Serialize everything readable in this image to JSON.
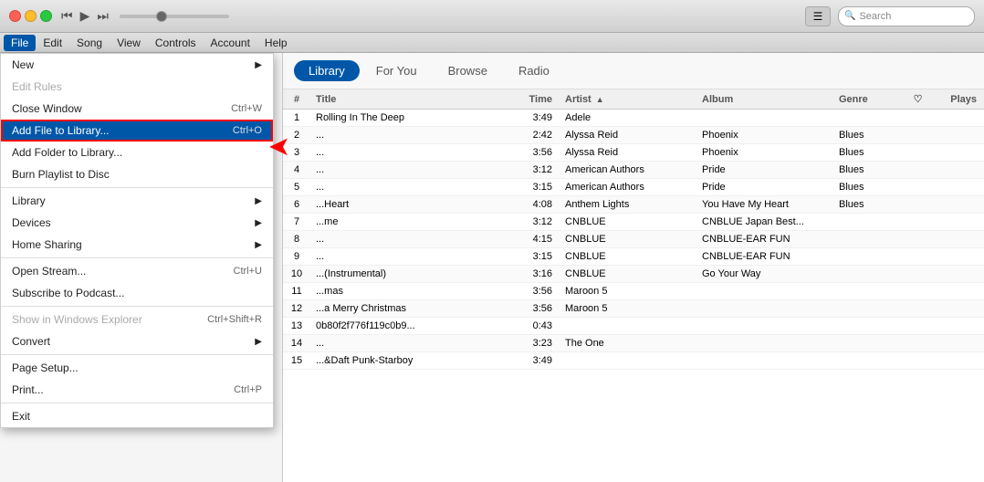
{
  "titleBar": {
    "searchPlaceholder": "Search",
    "appleIcon": "",
    "listViewIcon": "☰"
  },
  "menuBar": {
    "items": [
      "File",
      "Edit",
      "Song",
      "View",
      "Controls",
      "Account",
      "Help"
    ]
  },
  "fileMenu": {
    "items": [
      {
        "label": "New",
        "shortcut": "",
        "arrow": "▶",
        "disabled": false
      },
      {
        "label": "Edit Rules",
        "shortcut": "",
        "arrow": "",
        "disabled": true
      },
      {
        "label": "Close Window",
        "shortcut": "Ctrl+W",
        "arrow": "",
        "disabled": false
      },
      {
        "label": "Add File to Library...",
        "shortcut": "Ctrl+O",
        "arrow": "",
        "disabled": false,
        "highlighted": true
      },
      {
        "label": "Add Folder to Library...",
        "shortcut": "",
        "arrow": "",
        "disabled": false
      },
      {
        "label": "Burn Playlist to Disc",
        "shortcut": "",
        "arrow": "",
        "disabled": false
      },
      {
        "separator": true
      },
      {
        "label": "Library",
        "shortcut": "",
        "arrow": "▶",
        "disabled": false
      },
      {
        "label": "Devices",
        "shortcut": "",
        "arrow": "▶",
        "disabled": false
      },
      {
        "label": "Home Sharing",
        "shortcut": "",
        "arrow": "▶",
        "disabled": false
      },
      {
        "separator": true
      },
      {
        "label": "Open Stream...",
        "shortcut": "Ctrl+U",
        "arrow": "",
        "disabled": false
      },
      {
        "label": "Subscribe to Podcast...",
        "shortcut": "",
        "arrow": "",
        "disabled": false
      },
      {
        "separator": true
      },
      {
        "label": "Show in Windows Explorer",
        "shortcut": "Ctrl+Shift+R",
        "arrow": "",
        "disabled": true
      },
      {
        "label": "Convert",
        "shortcut": "",
        "arrow": "▶",
        "disabled": false
      },
      {
        "separator": true
      },
      {
        "label": "Page Setup...",
        "shortcut": "",
        "arrow": "",
        "disabled": false
      },
      {
        "label": "Print...",
        "shortcut": "Ctrl+P",
        "arrow": "",
        "disabled": false
      },
      {
        "separator": true
      },
      {
        "label": "Exit",
        "shortcut": "",
        "arrow": "",
        "disabled": false
      }
    ]
  },
  "navTabs": {
    "items": [
      "Library",
      "For You",
      "Browse",
      "Radio"
    ],
    "active": "Library"
  },
  "tableHeaders": {
    "num": "#",
    "title": "Title",
    "time": "Time",
    "artist": "Artist",
    "album": "Album",
    "genre": "Genre",
    "heart": "♡",
    "plays": "Plays"
  },
  "songs": [
    {
      "title": "Rolling In The Deep",
      "time": "3:49",
      "artist": "Adele",
      "album": "",
      "genre": ""
    },
    {
      "title": "...",
      "time": "2:42",
      "artist": "Alyssa Reid",
      "album": "Phoenix",
      "genre": "Blues"
    },
    {
      "title": "...",
      "time": "3:56",
      "artist": "Alyssa Reid",
      "album": "Phoenix",
      "genre": "Blues"
    },
    {
      "title": "...",
      "time": "3:12",
      "artist": "American Authors",
      "album": "Pride",
      "genre": "Blues"
    },
    {
      "title": "...",
      "time": "3:15",
      "artist": "American Authors",
      "album": "Pride",
      "genre": "Blues"
    },
    {
      "title": "...Heart",
      "time": "4:08",
      "artist": "Anthem Lights",
      "album": "You Have My Heart",
      "genre": "Blues"
    },
    {
      "title": "...me",
      "time": "3:12",
      "artist": "CNBLUE",
      "album": "CNBLUE Japan Best...",
      "genre": ""
    },
    {
      "title": "...",
      "time": "4:15",
      "artist": "CNBLUE",
      "album": "CNBLUE-EAR FUN",
      "genre": ""
    },
    {
      "title": "...",
      "time": "3:15",
      "artist": "CNBLUE",
      "album": "CNBLUE-EAR FUN",
      "genre": ""
    },
    {
      "title": "...(Instrumental)",
      "time": "3:16",
      "artist": "CNBLUE",
      "album": "Go Your Way",
      "genre": ""
    },
    {
      "title": "...mas",
      "time": "3:56",
      "artist": "Maroon 5",
      "album": "",
      "genre": ""
    },
    {
      "title": "...a Merry Christmas",
      "time": "3:56",
      "artist": "Maroon 5",
      "album": "",
      "genre": ""
    },
    {
      "title": "0b80f2f776f119c0b9...",
      "time": "0:43",
      "artist": "",
      "album": "",
      "genre": ""
    },
    {
      "title": "...",
      "time": "3:23",
      "artist": "The One",
      "album": "",
      "genre": ""
    },
    {
      "title": "...&Daft Punk-Starboy",
      "time": "3:49",
      "artist": "",
      "album": "",
      "genre": ""
    }
  ]
}
